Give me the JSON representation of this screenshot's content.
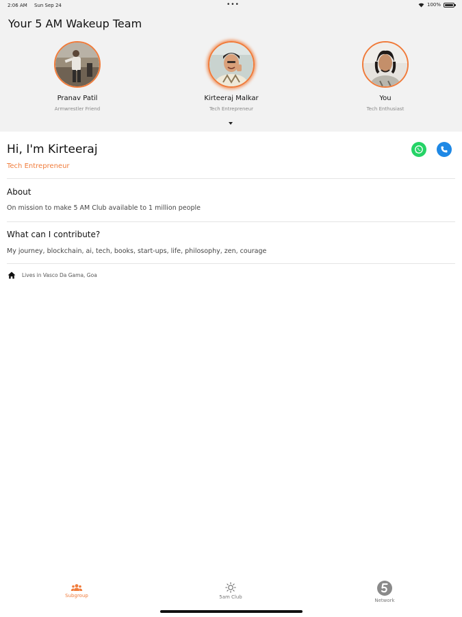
{
  "status_bar": {
    "time": "2:06 AM",
    "date": "Sun Sep 24",
    "dots": "•••",
    "battery": "100%"
  },
  "header": {
    "title": "Your 5 AM Wakeup Team",
    "members": [
      {
        "name": "Pranav Patil",
        "role": "Armwrestler Friend",
        "selected": false
      },
      {
        "name": "Kirteeraj Malkar",
        "role": "Tech Entrepreneur",
        "selected": true
      },
      {
        "name": "You",
        "role": "Tech Enthusiast",
        "selected": false
      }
    ]
  },
  "profile": {
    "greeting": "Hi, I'm Kirteeraj",
    "title": "Tech Entrepreneur",
    "about_heading": "About",
    "about_text": "On mission to make 5 AM Club available to 1 million people",
    "contribute_heading": "What can I contribute?",
    "contribute_text": "My journey, blockchain, ai, tech, books, start-ups, life, philosophy, zen, courage",
    "location": "Lives in Vasco Da Gama, Goa"
  },
  "tabs": [
    {
      "label": "Subgroup",
      "active": true
    },
    {
      "label": "5am Club",
      "active": false
    },
    {
      "label": "Network",
      "active": false
    }
  ],
  "colors": {
    "accent": "#f07b3a",
    "header_bg": "#f2f2f2",
    "whatsapp": "#25d366",
    "call": "#1e88e5"
  }
}
